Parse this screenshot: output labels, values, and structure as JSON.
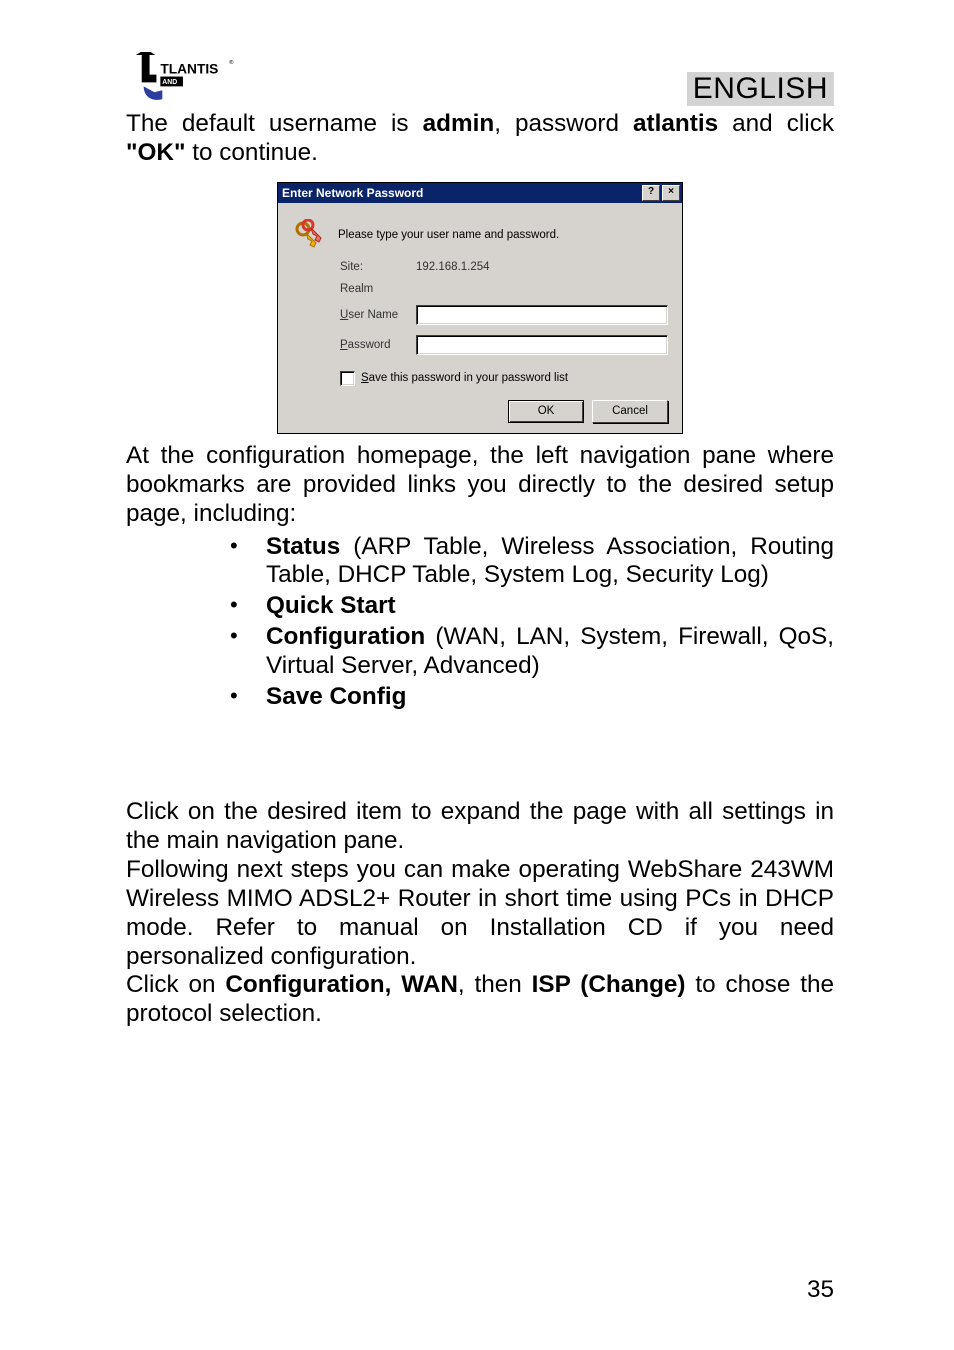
{
  "header": {
    "brand_main": "TLANTIS",
    "brand_sub": "AND",
    "brand_reg": "®",
    "lang_label": "ENGLISH"
  },
  "para1": {
    "pre": "The default username is ",
    "b1": "admin",
    "mid": ", password ",
    "b2": "atlantis",
    "post1": " and click ",
    "b3": "\"OK\"",
    "post2": " to continue."
  },
  "dialog": {
    "title": "Enter Network Password",
    "help": "?",
    "close": "×",
    "prompt": "Please type your user name and password.",
    "site_label": "Site:",
    "site_value": "192.168.1.254",
    "realm_label": "Realm",
    "user_label": "User Name",
    "pass_label": "Password",
    "save_label": "Save this password in your password list",
    "ok": "OK",
    "cancel": "Cancel",
    "user_value": "",
    "pass_value": ""
  },
  "para2": "At the configuration homepage, the left navigation pane where bookmarks are provided links you directly to the desired setup page, including:",
  "bullets": {
    "b1_bold": "Status",
    "b1_rest": " (ARP Table, Wireless Association, Routing Table, DHCP Table, System Log, Security Log)",
    "b2": "Quick Start",
    "b3_bold": "Configuration",
    "b3_rest": " (WAN, LAN, System, Firewall, QoS, Virtual Server, Advanced)",
    "b4": "Save Config"
  },
  "para3": "Click on the desired item to expand the page with all settings in the main navigation pane.",
  "para4": "Following next steps you can make operating WebShare 243WM Wireless MIMO ADSL2+ Router  in short time using PCs  in DHCP mode.  Refer to manual on Installation CD if you need personalized configuration.",
  "para5": {
    "pre": "Click on ",
    "b1": "Configuration, WAN",
    "mid": ", then ",
    "b2": "ISP (Change)",
    "post": " to chose the protocol selection."
  },
  "page_number": "35"
}
